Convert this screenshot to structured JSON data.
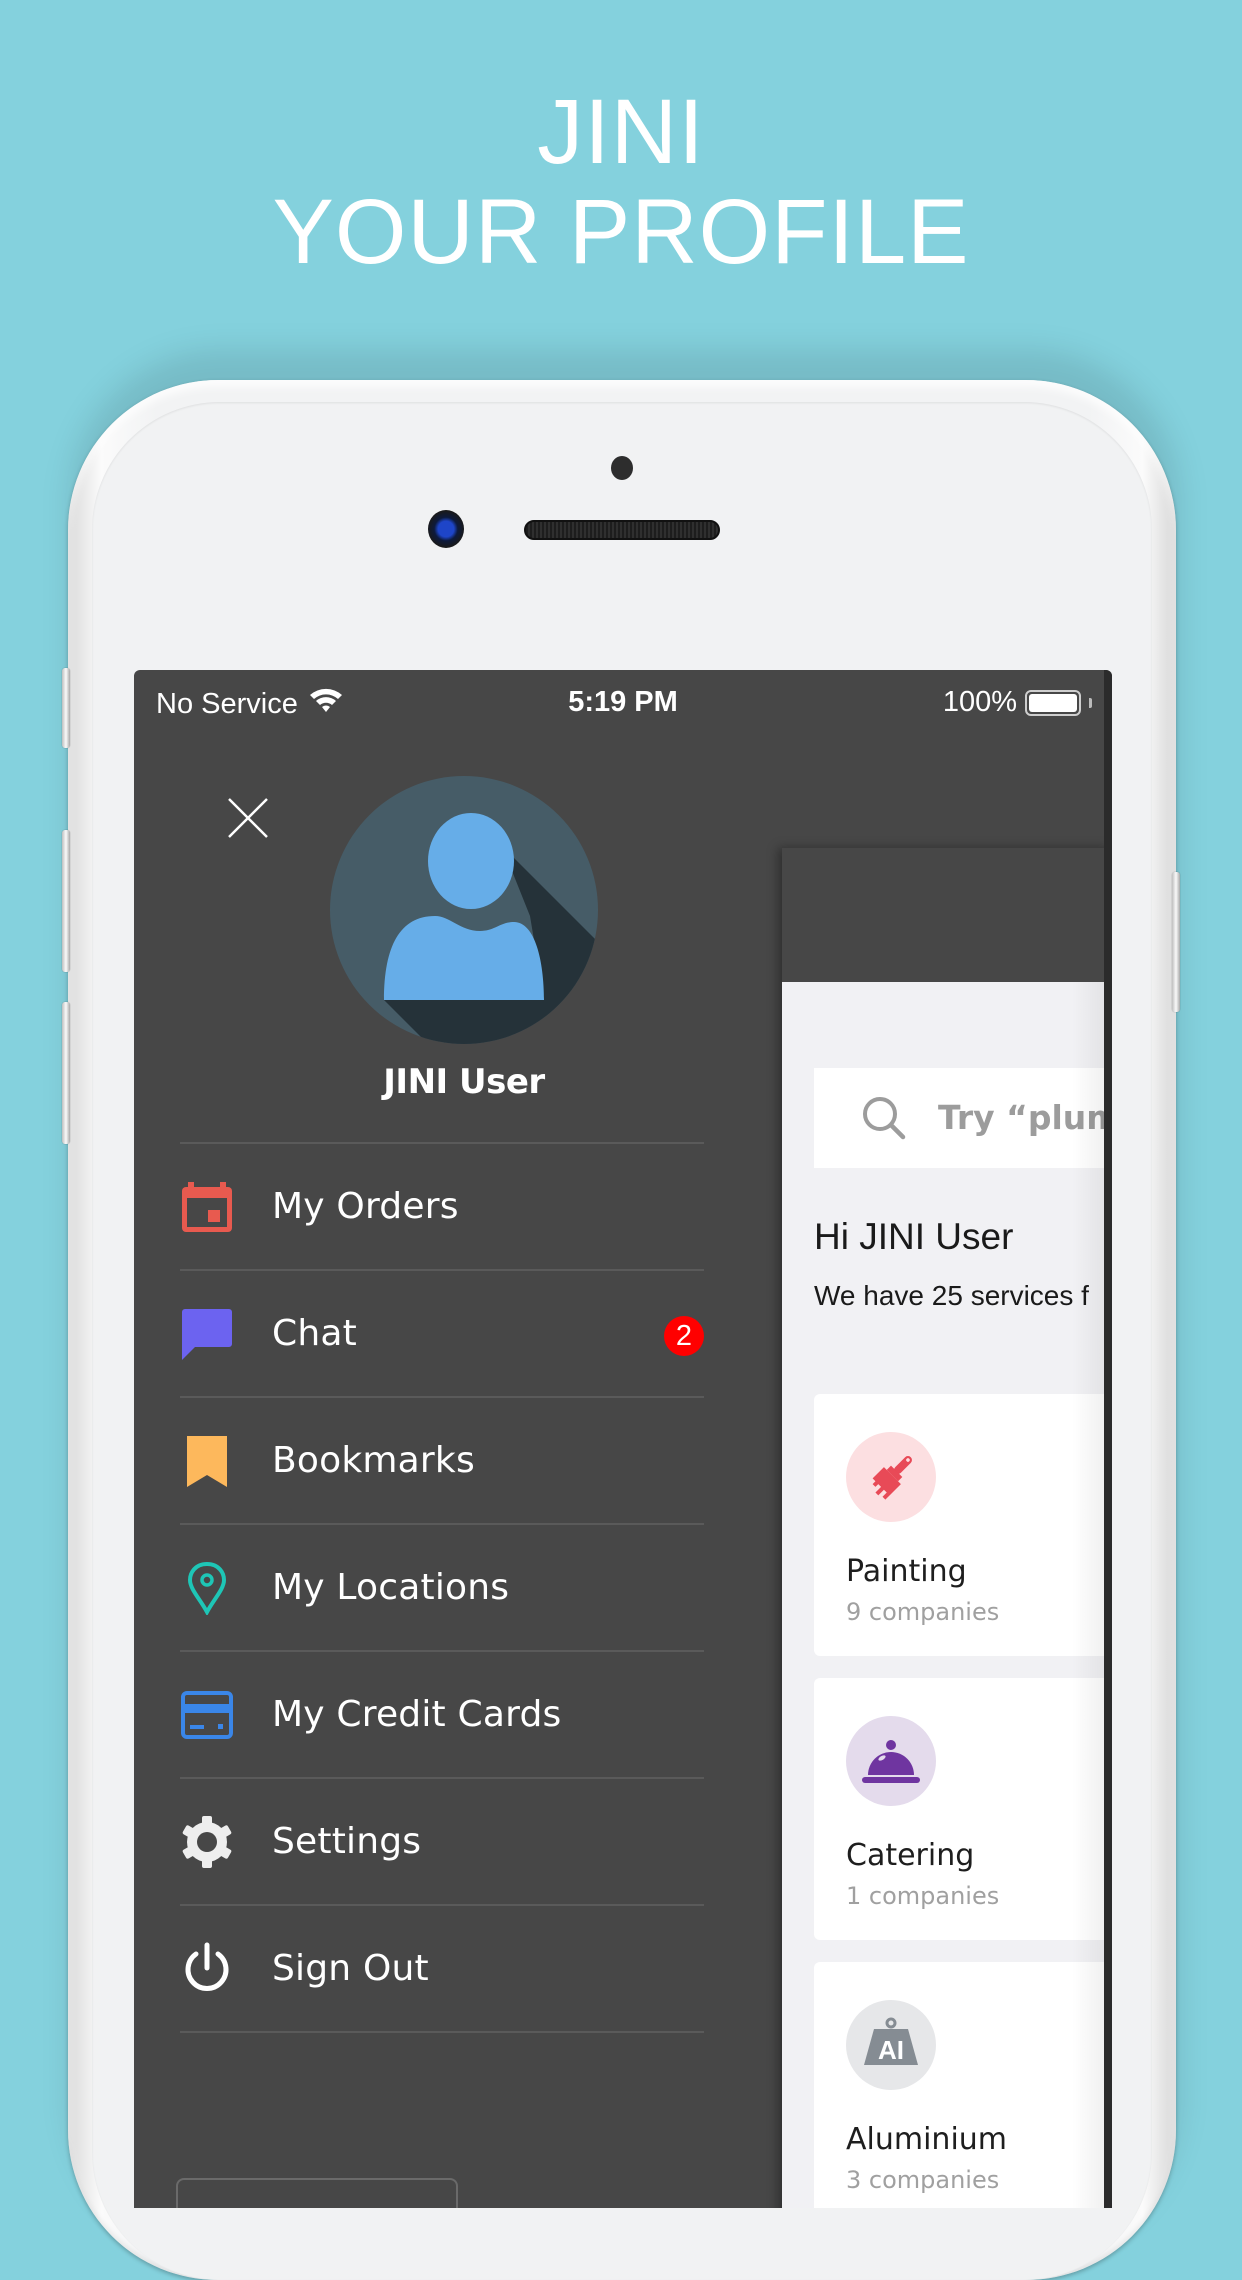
{
  "headline": {
    "line1": "JINI",
    "line2": "YOUR PROFILE"
  },
  "colors": {
    "background": "#84d1dd",
    "drawer": "#474747",
    "badge": "#ff0000",
    "orders_icon": "#e85a4f",
    "chat_icon": "#6c63f0",
    "bookmarks_icon": "#fdb85c",
    "locations_icon": "#1ec6b6",
    "credit_cards_icon": "#3a86e8"
  },
  "status_bar": {
    "carrier": "No Service",
    "time": "5:19 PM",
    "battery": "100%"
  },
  "drawer": {
    "user_name": "JINI User",
    "menu": [
      {
        "label": "My Orders",
        "icon": "calendar-icon"
      },
      {
        "label": "Chat",
        "icon": "chat-bubble-icon",
        "badge": "2"
      },
      {
        "label": "Bookmarks",
        "icon": "bookmark-icon"
      },
      {
        "label": "My Locations",
        "icon": "location-pin-icon"
      },
      {
        "label": "My Credit Cards",
        "icon": "credit-card-icon"
      },
      {
        "label": "Settings",
        "icon": "gear-icon"
      },
      {
        "label": "Sign Out",
        "icon": "power-icon"
      }
    ]
  },
  "main": {
    "search_placeholder": "Try “plumb",
    "greeting": "Hi JINI User",
    "subtitle": "We have 25 services f",
    "categories": [
      {
        "name": "Painting",
        "count": "9 companies",
        "icon": "paint-brush-icon"
      },
      {
        "name": "Catering",
        "count": "1 companies",
        "icon": "food-cloche-icon"
      },
      {
        "name": "Aluminium",
        "count": "3 companies",
        "icon": "aluminium-weight-icon",
        "icon_text": "AI"
      }
    ]
  }
}
